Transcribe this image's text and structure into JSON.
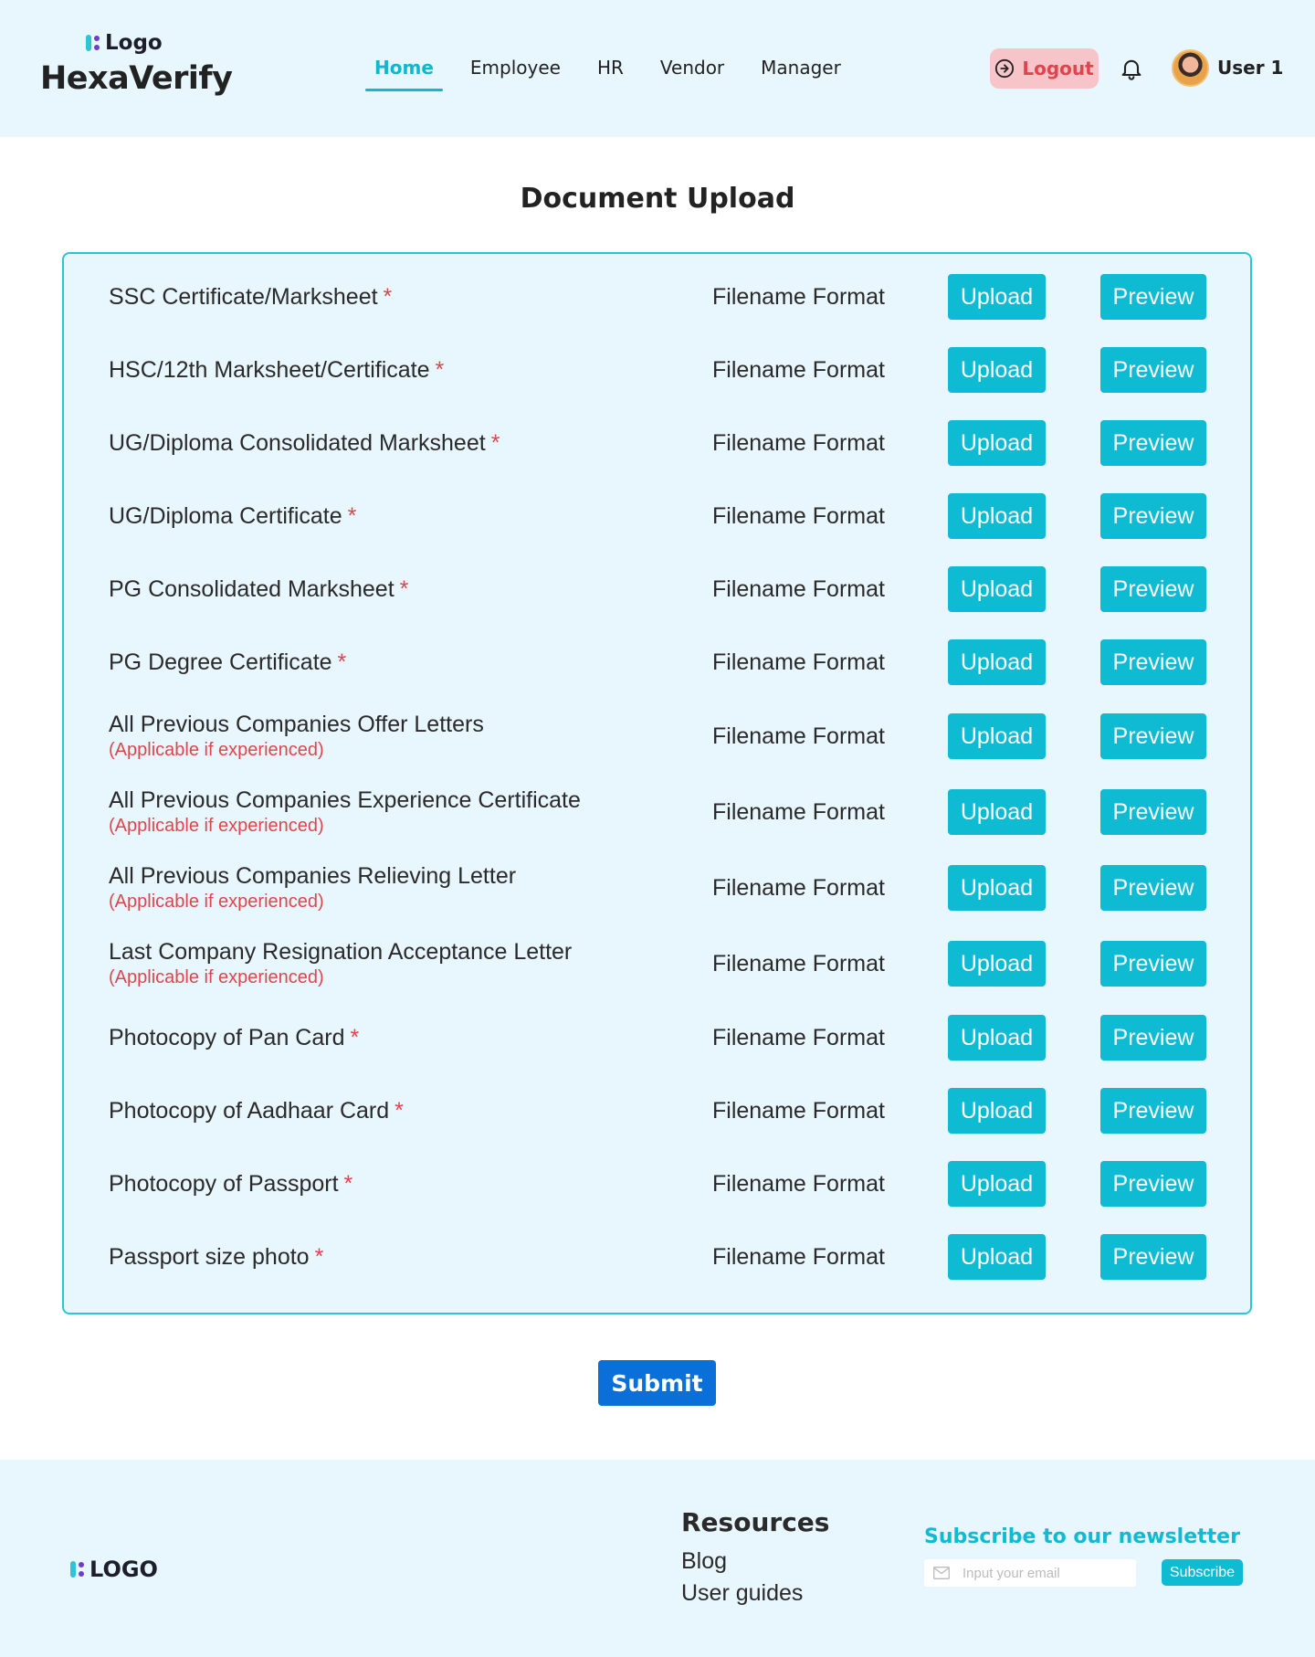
{
  "header": {
    "logo_text": "Logo",
    "app_title": "HexaVerify",
    "nav": [
      {
        "label": "Home",
        "active": true
      },
      {
        "label": "Employee",
        "active": false
      },
      {
        "label": "HR",
        "active": false
      },
      {
        "label": "Vendor",
        "active": false
      },
      {
        "label": "Manager",
        "active": false
      }
    ],
    "logout_label": "Logout",
    "user_name": "User 1"
  },
  "main": {
    "page_title": "Document Upload",
    "documents": [
      {
        "label": "SSC Certificate/Marksheet",
        "required": "*",
        "note": "",
        "filename": "Filename Format",
        "upload": "Upload",
        "preview": "Preview"
      },
      {
        "label": "HSC/12th Marksheet/Certificate",
        "required": "*",
        "note": "",
        "filename": "Filename Format",
        "upload": "Upload",
        "preview": "Preview"
      },
      {
        "label": "UG/Diploma Consolidated Marksheet",
        "required": "*",
        "note": "",
        "filename": "Filename Format",
        "upload": "Upload",
        "preview": "Preview"
      },
      {
        "label": "UG/Diploma Certificate",
        "required": "*",
        "note": "",
        "filename": "Filename Format",
        "upload": "Upload",
        "preview": "Preview"
      },
      {
        "label": "PG Consolidated Marksheet",
        "required": "*",
        "note": "",
        "filename": "Filename Format",
        "upload": "Upload",
        "preview": "Preview"
      },
      {
        "label": "PG Degree Certificate",
        "required": "*",
        "note": "",
        "filename": "Filename Format",
        "upload": "Upload",
        "preview": "Preview"
      },
      {
        "label": "All Previous Companies Offer Letters",
        "required": "",
        "note": "(Applicable if experienced)",
        "filename": "Filename Format",
        "upload": "Upload",
        "preview": "Preview"
      },
      {
        "label": "All Previous Companies Experience Certificate",
        "required": "",
        "note": "(Applicable if experienced)",
        "filename": "Filename Format",
        "upload": "Upload",
        "preview": "Preview"
      },
      {
        "label": "All Previous Companies Relieving Letter",
        "required": "",
        "note": "(Applicable if experienced)",
        "filename": "Filename Format",
        "upload": "Upload",
        "preview": "Preview"
      },
      {
        "label": "Last Company Resignation Acceptance Letter",
        "required": "",
        "note": "(Applicable if experienced)",
        "filename": "Filename Format",
        "upload": "Upload",
        "preview": "Preview"
      },
      {
        "label": "Photocopy of Pan Card",
        "required": "*",
        "note": "",
        "filename": "Filename Format",
        "upload": "Upload",
        "preview": "Preview"
      },
      {
        "label": "Photocopy of Aadhaar Card",
        "required": "*",
        "note": "",
        "filename": "Filename Format",
        "upload": "Upload",
        "preview": "Preview"
      },
      {
        "label": "Photocopy of Passport",
        "required": "*",
        "note": "",
        "filename": "Filename Format",
        "upload": "Upload",
        "preview": "Preview"
      },
      {
        "label": "Passport size photo",
        "required": "*",
        "note": "",
        "filename": "Filename Format",
        "upload": "Upload",
        "preview": "Preview"
      }
    ],
    "submit_label": "Submit"
  },
  "footer": {
    "logo_text": "LOGO",
    "resources_title": "Resources",
    "resources_links": [
      "Blog",
      "User guides"
    ],
    "newsletter_title": "Subscribe to our newsletter",
    "email_placeholder": "Input your email",
    "subscribe_label": "Subscribe"
  },
  "colors": {
    "accent": "#0fbbd3",
    "primary": "#0a6fd9",
    "danger": "#e0454d",
    "panel_bg": "#e8f6fd"
  }
}
